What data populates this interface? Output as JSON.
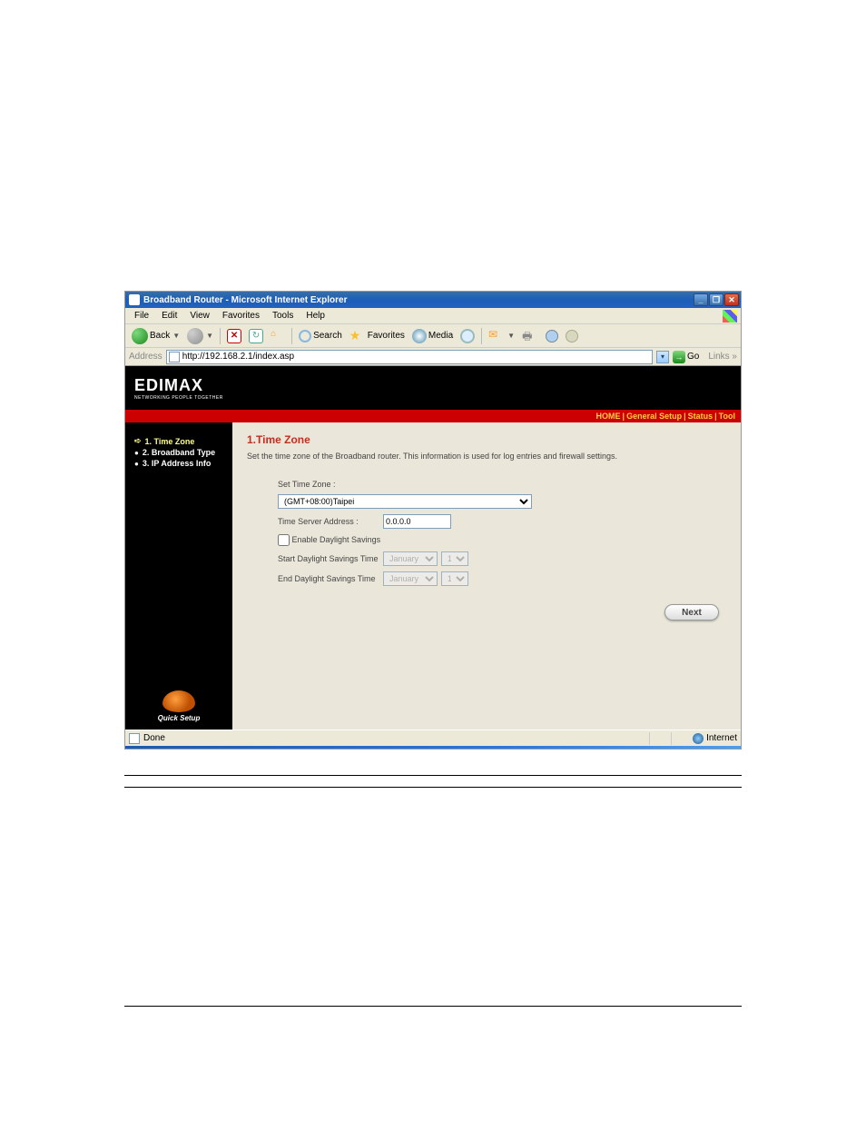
{
  "window": {
    "title": "Broadband Router - Microsoft Internet Explorer"
  },
  "menus": {
    "file": "File",
    "edit": "Edit",
    "view": "View",
    "favorites": "Favorites",
    "tools": "Tools",
    "help": "Help"
  },
  "toolbar": {
    "back": "Back",
    "search": "Search",
    "favorites": "Favorites",
    "media": "Media"
  },
  "address": {
    "label": "Address",
    "url": "http://192.168.2.1/index.asp",
    "go": "Go",
    "links": "Links »"
  },
  "brand": {
    "logo": "EDIMAX",
    "tagline": "NETWORKING PEOPLE TOGETHER"
  },
  "topnav": {
    "home": "HOME",
    "general": "General Setup",
    "status": "Status",
    "tool": "Tool"
  },
  "sidebar": {
    "items": [
      {
        "label": "1. Time Zone"
      },
      {
        "label": "2. Broadband Type"
      },
      {
        "label": "3. IP Address Info"
      }
    ],
    "quick": "Quick Setup"
  },
  "page": {
    "heading": "1.Time Zone",
    "desc": "Set the time zone of the Broadband router. This information is used for log entries and firewall settings.",
    "set_tz_label": "Set Time Zone :",
    "tz_value": "(GMT+08:00)Taipei",
    "server_label": "Time Server Address :",
    "server_value": "0.0.0.0",
    "dst_enable": "Enable Daylight Savings",
    "dst_start": "Start Daylight Savings Time",
    "dst_end": "End Daylight Savings Time",
    "month": "January",
    "day": "1",
    "next": "Next"
  },
  "status": {
    "done": "Done",
    "zone": "Internet"
  }
}
